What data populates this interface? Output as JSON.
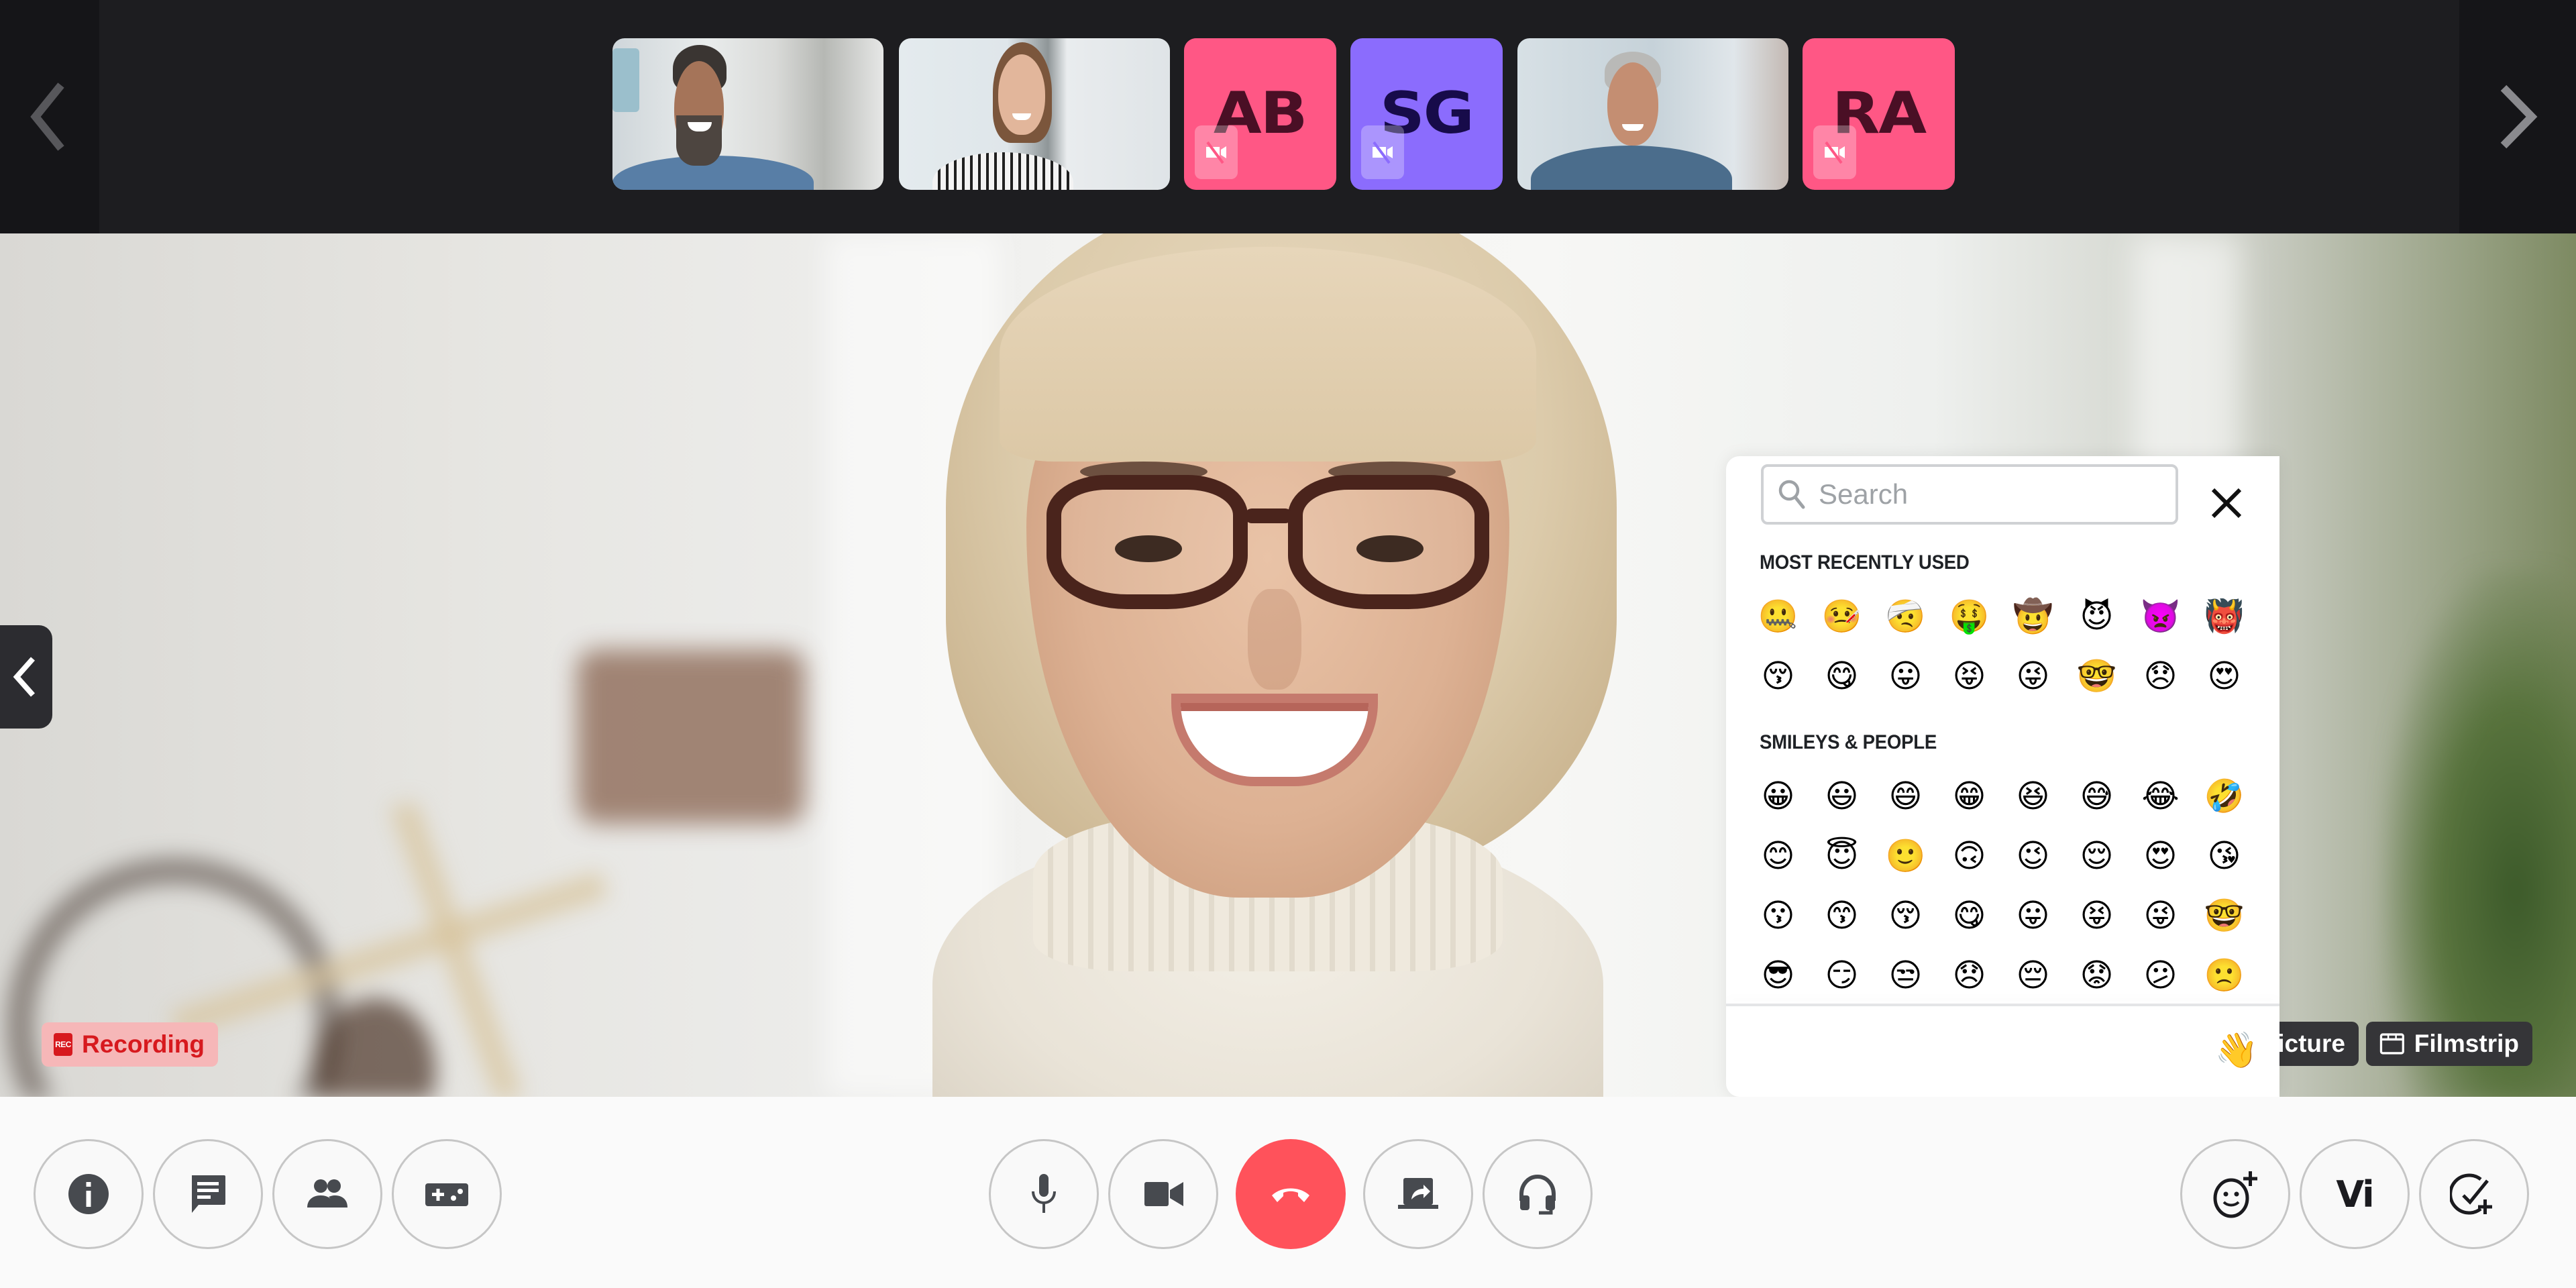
{
  "filmstrip": {
    "prev_label": "Previous participants",
    "next_label": "Next participants",
    "participants": [
      {
        "type": "video",
        "description": "Man with beard and earphones"
      },
      {
        "type": "video",
        "description": "Woman in striped blouse"
      },
      {
        "type": "avatar",
        "initials": "AB",
        "bg_color": "#ff5785",
        "text_color": "#4a0f25",
        "camera": "off"
      },
      {
        "type": "avatar",
        "initials": "SG",
        "bg_color": "#8b6cfd",
        "text_color": "#170b4a",
        "camera": "off"
      },
      {
        "type": "video",
        "description": "Grey-haired man in denim shirt"
      },
      {
        "type": "avatar",
        "initials": "RA",
        "bg_color": "#ff5785",
        "text_color": "#4a0f25",
        "camera": "off"
      }
    ]
  },
  "main_video": {
    "description": "Blonde woman with glasses smiling",
    "recording_label": "Recording",
    "recording_icon_text": "REC",
    "view_buttons": {
      "picture_label": "icture",
      "filmstrip_label": "Filmstrip"
    }
  },
  "emoji_picker": {
    "search_placeholder": "Search",
    "search_value": "",
    "sections": [
      {
        "title": "MOST RECENTLY USED",
        "emojis": [
          "🤐",
          "🤒",
          "🤕",
          "🤑",
          "🤠",
          "😈",
          "👿",
          "👹",
          "😚",
          "😋",
          "😛",
          "😝",
          "😜",
          "🤓",
          "😞",
          "😍"
        ]
      },
      {
        "title": "SMILEYS & PEOPLE",
        "emojis": [
          "😀",
          "😃",
          "😄",
          "😁",
          "😆",
          "😅",
          "😂",
          "🤣",
          "😊",
          "😇",
          "🙂",
          "🙃",
          "😉",
          "😌",
          "😍",
          "😘",
          "😗",
          "😙",
          "😚",
          "😋",
          "😛",
          "😝",
          "😜",
          "🤓",
          "😎",
          "😏",
          "😒",
          "😞",
          "😔",
          "😟",
          "😕",
          "🙁"
        ]
      }
    ],
    "skin_tone_emoji": "👋"
  },
  "controls": {
    "left": [
      {
        "name": "info",
        "label": "Info"
      },
      {
        "name": "chat",
        "label": "Chat"
      },
      {
        "name": "participants",
        "label": "Participants"
      },
      {
        "name": "games",
        "label": "Games"
      }
    ],
    "center": [
      {
        "name": "microphone",
        "label": "Microphone"
      },
      {
        "name": "camera",
        "label": "Camera"
      },
      {
        "name": "end-call",
        "label": "End call"
      },
      {
        "name": "share-screen",
        "label": "Share screen"
      },
      {
        "name": "audio-settings",
        "label": "Headset"
      }
    ],
    "right": [
      {
        "name": "add-reaction",
        "label": "Add reaction"
      },
      {
        "name": "vi",
        "label": "Vi"
      },
      {
        "name": "add-task",
        "label": "Add task"
      }
    ]
  },
  "colors": {
    "end_call": "#ff525b",
    "recording": "#d7191e",
    "avatar_pink": "#ff5785",
    "avatar_purple": "#8b6cfd"
  }
}
